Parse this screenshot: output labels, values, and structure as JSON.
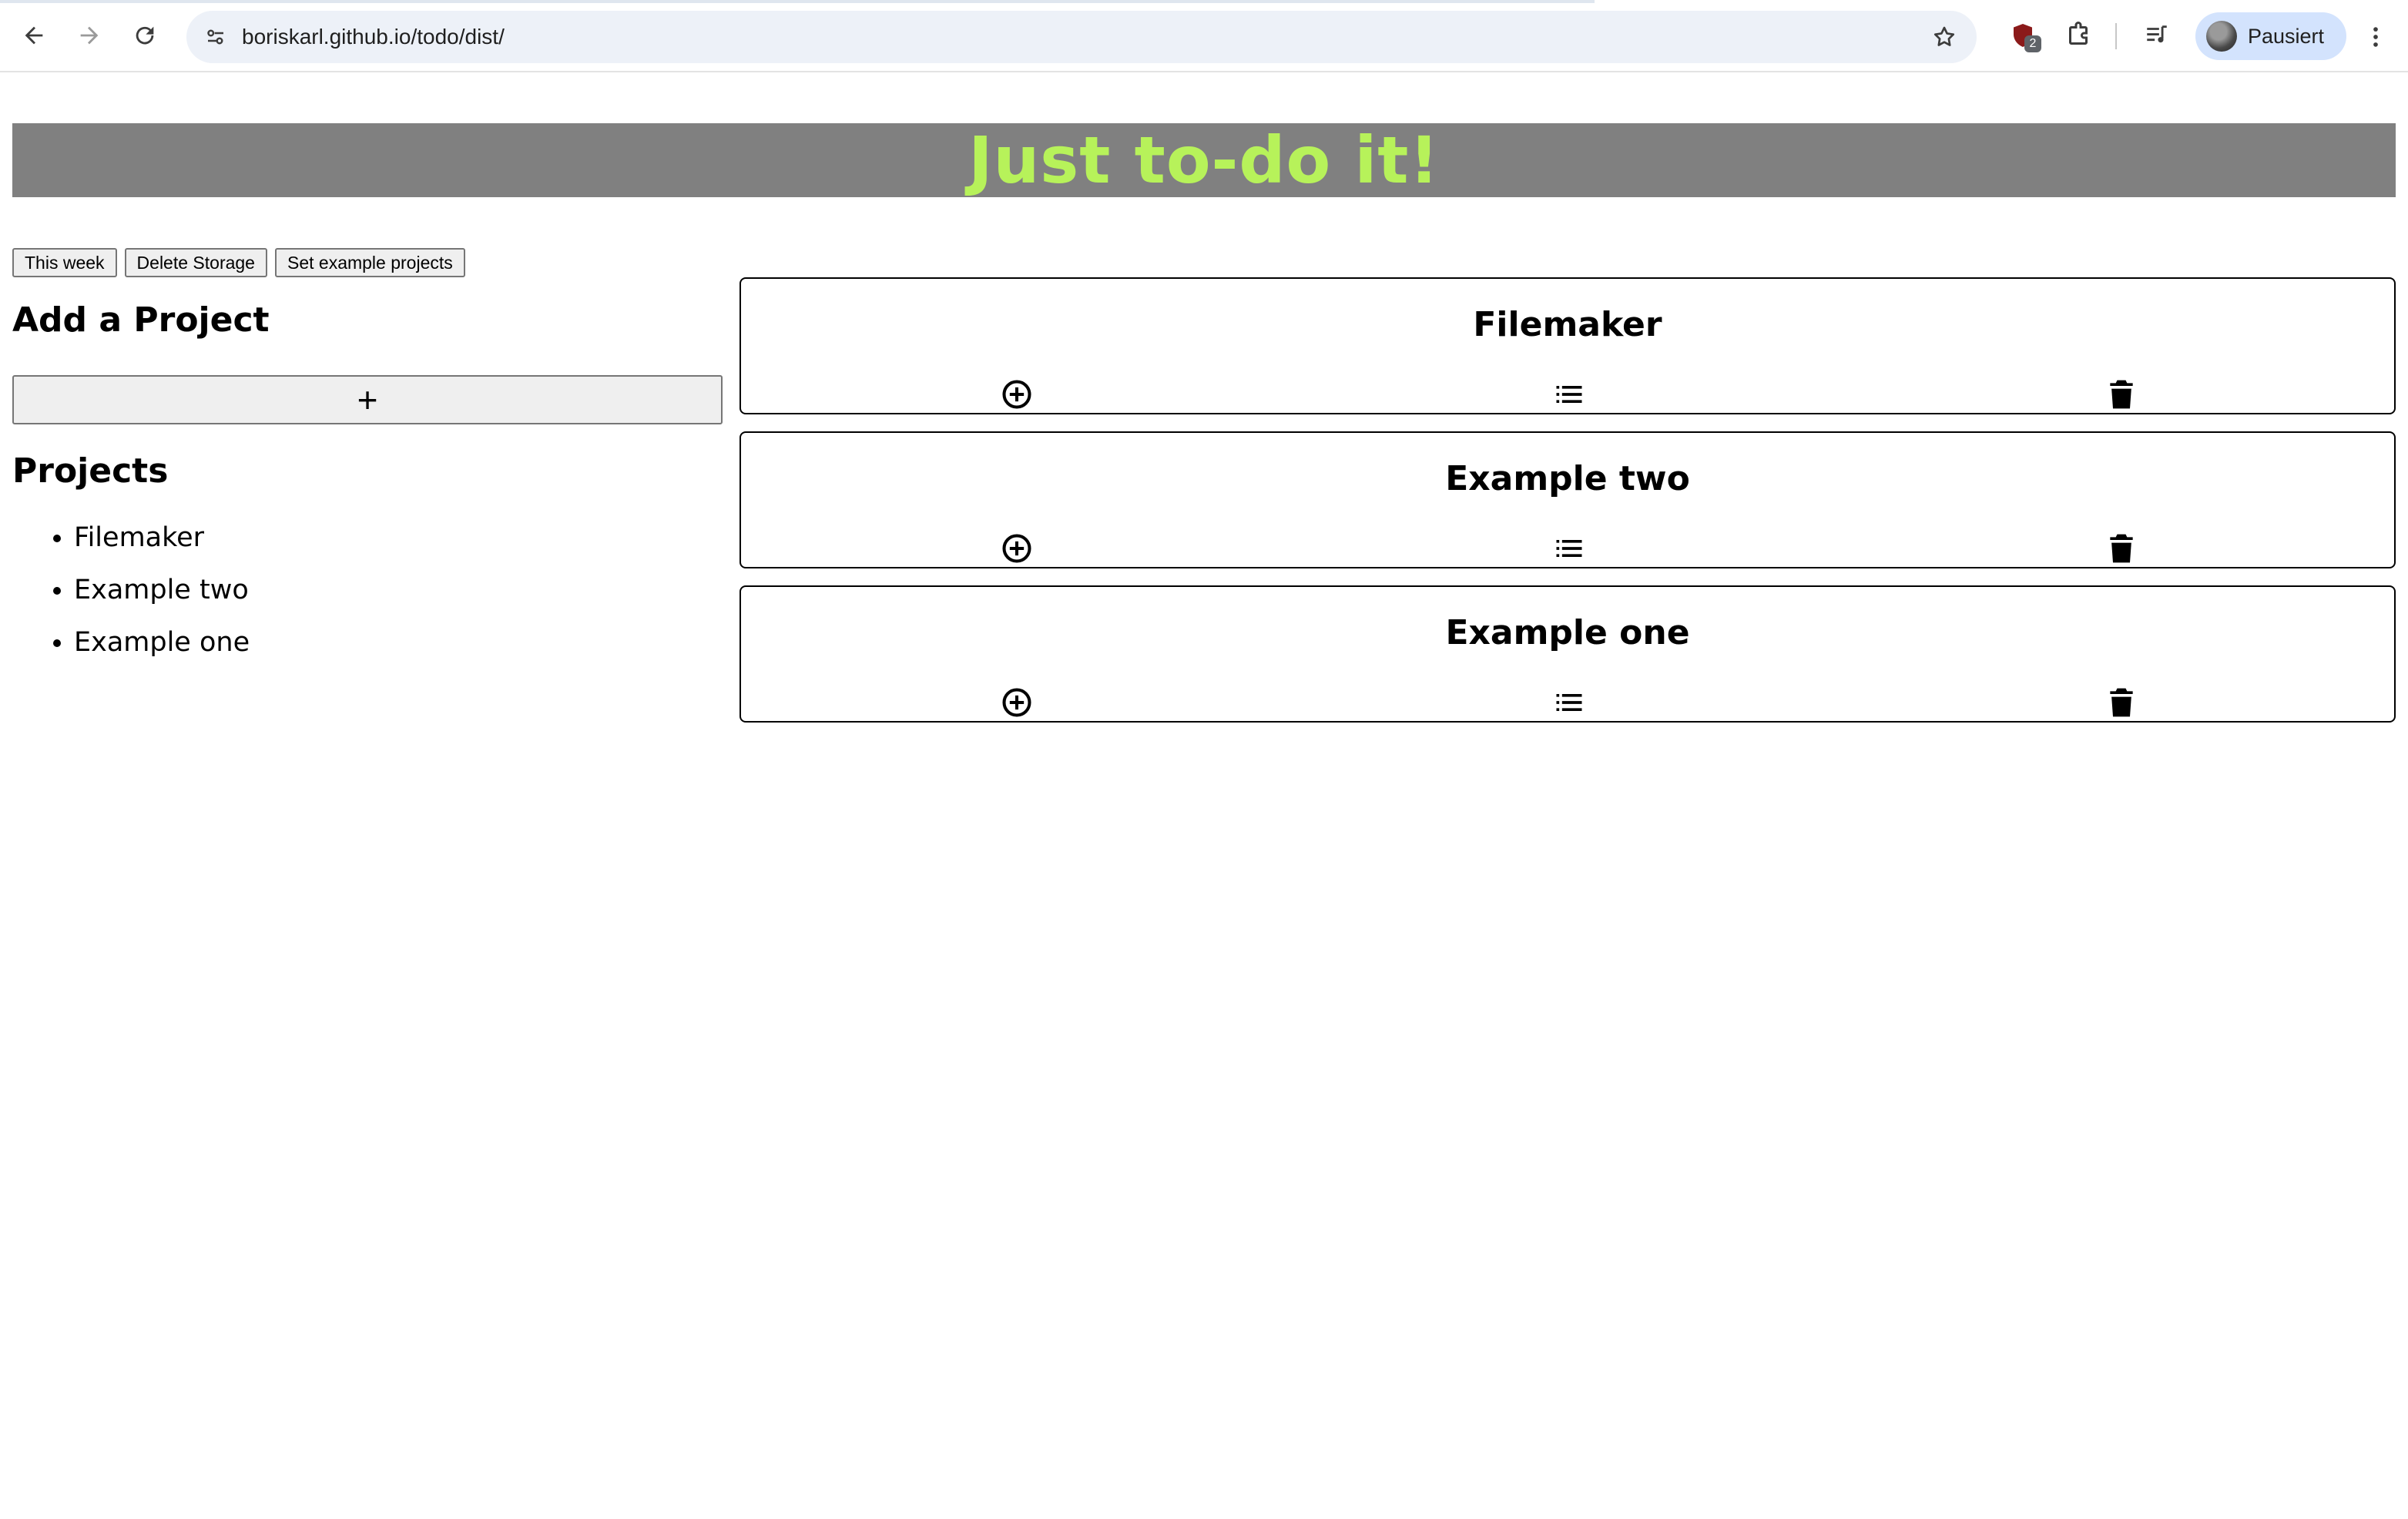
{
  "browser": {
    "url": "boriskarl.github.io/todo/dist/",
    "extension_badge": "2",
    "profile_name": "Pausiert",
    "icons": [
      "back-arrow-icon",
      "forward-arrow-icon",
      "reload-icon",
      "site-settings-icon",
      "star-icon",
      "extension-shield-icon",
      "extensions-puzzle-icon",
      "media-queue-icon",
      "menu-kebab-icon"
    ]
  },
  "header": {
    "title": "Just to-do it!",
    "title_color": "#b7f25a",
    "background_color": "#808080"
  },
  "toolbar": {
    "this_week_label": "This week",
    "delete_storage_label": "Delete Storage",
    "set_examples_label": "Set example projects"
  },
  "sidebar": {
    "add_title": "Add a Project",
    "add_button_label": "+",
    "projects_title": "Projects",
    "projects": [
      "Filemaker",
      "Example two",
      "Example one"
    ]
  },
  "cards": [
    {
      "title": "Filemaker",
      "icons": [
        "add-circle-icon",
        "list-icon",
        "trash-icon"
      ]
    },
    {
      "title": "Example two",
      "icons": [
        "add-circle-icon",
        "list-icon",
        "trash-icon"
      ]
    },
    {
      "title": "Example one",
      "icons": [
        "add-circle-icon",
        "list-icon",
        "trash-icon"
      ]
    }
  ]
}
